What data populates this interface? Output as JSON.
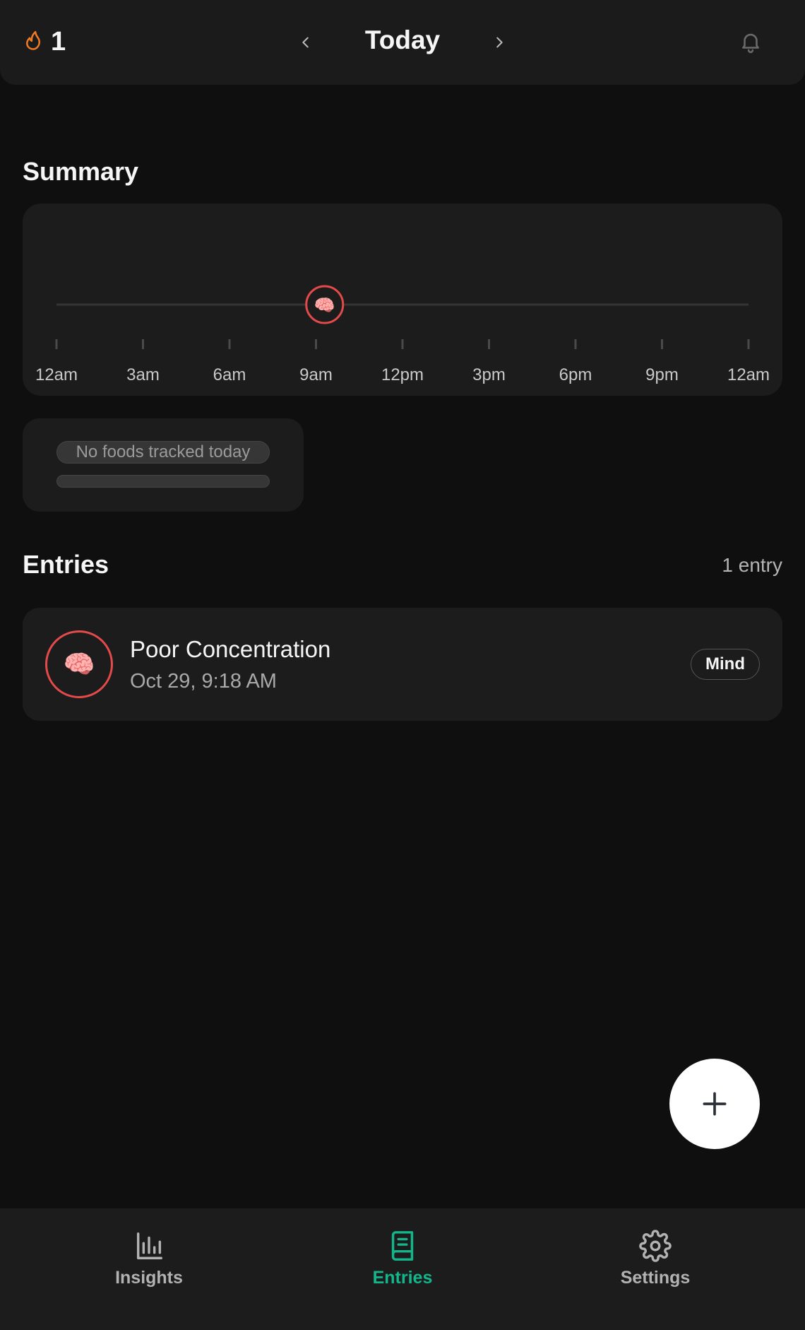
{
  "header": {
    "streak_count": "1",
    "date_title": "Today",
    "streak_icon": "flame-icon",
    "notification_icon": "bell-icon",
    "accent_color": "#f07a24"
  },
  "summary": {
    "title": "Summary",
    "time_labels": [
      "12am",
      "3am",
      "6am",
      "9am",
      "12pm",
      "3pm",
      "6pm",
      "9pm",
      "12am"
    ],
    "markers": [
      {
        "hour": 9.3,
        "emoji": "🧠",
        "color": "#e34a4a"
      }
    ]
  },
  "foods": {
    "empty_label": "No foods tracked today"
  },
  "entries": {
    "title": "Entries",
    "count_label": "1 entry",
    "items": [
      {
        "emoji": "🧠",
        "title": "Poor Concentration",
        "time": "Oct 29, 9:18 AM",
        "tag": "Mind",
        "ring_color": "#e34a4a"
      }
    ]
  },
  "fab": {
    "icon": "plus-icon"
  },
  "bottom_nav": {
    "active_color": "#13b58a",
    "tabs": [
      {
        "label": "Insights",
        "icon": "bar-chart-icon",
        "active": false
      },
      {
        "label": "Entries",
        "icon": "book-icon",
        "active": true
      },
      {
        "label": "Settings",
        "icon": "gear-icon",
        "active": false
      }
    ]
  }
}
